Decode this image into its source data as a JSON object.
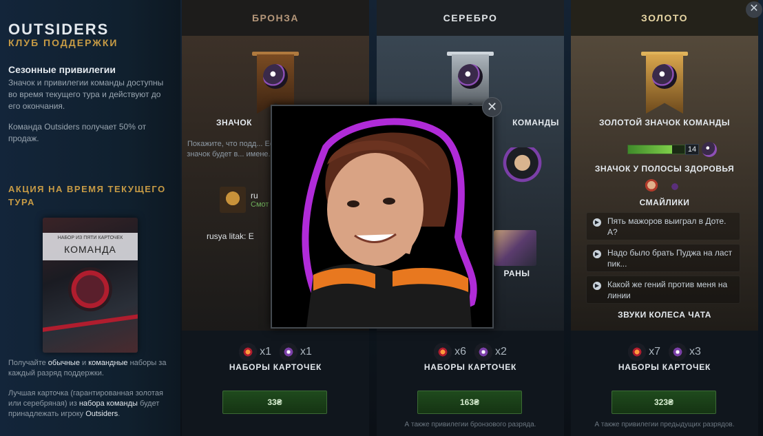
{
  "sidebar": {
    "title": "OUTSIDERS",
    "subtitle": "КЛУБ ПОДДЕРЖКИ",
    "privileges_title": "Сезонные привилегии",
    "privileges_text": "Значок и привилегии команды доступны во время текущего тура и действуют до его окончания.",
    "privileges_text2": "Команда Outsiders получает 50% от продаж.",
    "promo_title": "АКЦИЯ НА ВРЕМЯ ТЕКУЩЕГО ТУРА",
    "pack_small": "НАБОР ИЗ ПЯТИ КАРТОЧЕК",
    "pack_big": "КОМАНДА",
    "note1_a": "Получайте ",
    "note1_b": "обычные",
    "note1_c": " и ",
    "note1_d": "командные",
    "note1_e": " наборы за каждый разряд поддержки.",
    "note2_a": "Лучшая карточка (гарантированная золотая или серебряная) из ",
    "note2_b": "набора команды",
    "note2_c": " будет принадлежать игроку ",
    "note2_d": "Outsiders",
    "note2_e": "."
  },
  "tiers": {
    "bronze": {
      "label": "БРОНЗА",
      "badge_title": "ЗНАЧОК",
      "desc": "Покажите, что подд... Её значок будет в... имене...",
      "chat_name": "ru",
      "chat_sub": "Смот",
      "chat2_name": "rusya litak:",
      "chat2_text": "E",
      "packs": [
        {
          "count": "x1"
        },
        {
          "count": "x1"
        }
      ],
      "packs_label": "НАБОРЫ КАРТОЧЕК",
      "price": "33₴",
      "note": ""
    },
    "silver": {
      "label": "СЕРЕБРО",
      "badge_title": "КОМАНДЫ",
      "extra_label": "РАНЫ",
      "packs": [
        {
          "count": "x6"
        },
        {
          "count": "x2"
        }
      ],
      "packs_label": "НАБОРЫ КАРТОЧЕК",
      "price": "163₴",
      "note": "А также привилегии бронзового разряда."
    },
    "gold": {
      "label": "ЗОЛОТО",
      "badge_title": "ЗОЛОТОЙ ЗНАЧОК КОМАНДЫ",
      "hp_level": "14",
      "hp_fill": 0.78,
      "hp_label": "ЗНАЧОК У ПОЛОСЫ ЗДОРОВЬЯ",
      "emotes_label": "СМАЙЛИКИ",
      "sounds": [
        "Пять мажоров выиграл в Доте. А?",
        "Надо было брать Пуджа на ласт пик...",
        "Какой же гений против меня на линии"
      ],
      "sounds_label": "ЗВУКИ КОЛЕСА ЧАТА",
      "packs": [
        {
          "count": "x7"
        },
        {
          "count": "x3"
        }
      ],
      "packs_label": "НАБОРЫ КАРТОЧЕК",
      "price": "323₴",
      "note": "А также привилегии предыдущих разрядов."
    }
  },
  "popup": {
    "close_icon": "close-icon"
  },
  "colors": {
    "accent_gold": "#c79b45",
    "button_green": "#1f4a1d"
  }
}
